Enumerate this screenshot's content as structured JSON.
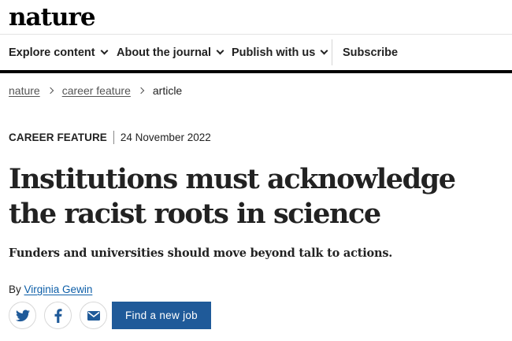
{
  "site": {
    "logo": "nature"
  },
  "nav": {
    "items": [
      {
        "label": "Explore content"
      },
      {
        "label": "About the journal"
      },
      {
        "label": "Publish with us"
      }
    ],
    "subscribe": "Subscribe"
  },
  "breadcrumb": {
    "items": [
      "nature",
      "career feature"
    ],
    "current": "article"
  },
  "article": {
    "type": "CAREER FEATURE",
    "date": "24 November 2022",
    "title": "Institutions must acknowledge the racist roots in science",
    "standfirst": "Funders and universities should move beyond talk to actions.",
    "byline_prefix": "By",
    "author": "Virginia Gewin"
  },
  "share": {
    "icons": [
      "twitter-icon",
      "facebook-icon",
      "email-icon"
    ]
  },
  "cta": {
    "label": "Find a new job"
  },
  "colors": {
    "accent": "#1f5a99",
    "link": "#0c5ea8",
    "text": "#222222"
  }
}
